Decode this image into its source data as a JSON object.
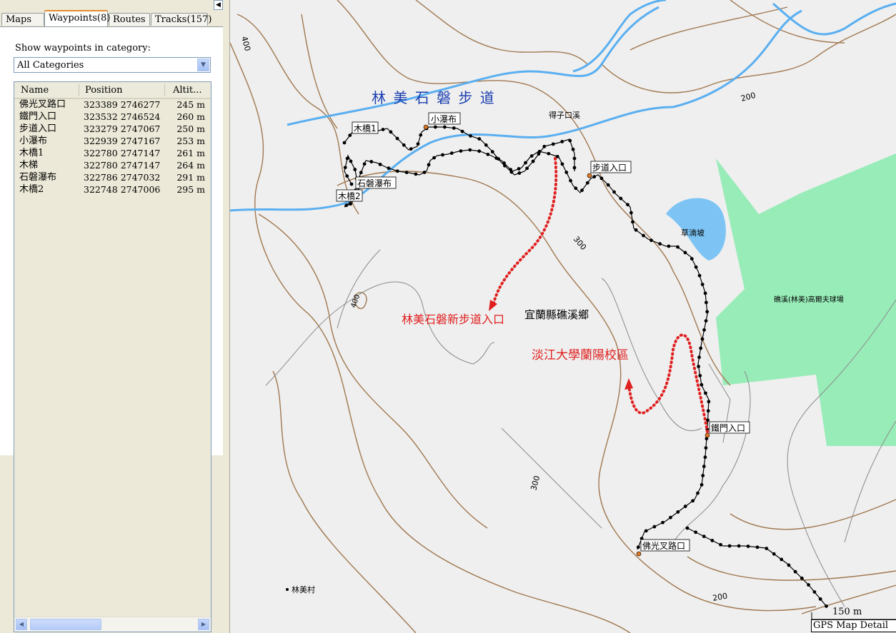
{
  "tabs": [
    {
      "label": "Maps"
    },
    {
      "label": "Waypoints(8)"
    },
    {
      "label": "Routes"
    },
    {
      "label": "Tracks(157)"
    }
  ],
  "category": {
    "label": "Show waypoints in category:",
    "selected": "All Categories"
  },
  "columns": {
    "name": "Name",
    "position": "Position",
    "altitude": "Altit..."
  },
  "waypoints": [
    {
      "name": "佛光叉路口",
      "position": "323389 2746277",
      "altitude": "245 m"
    },
    {
      "name": "鐵門入口",
      "position": "323532 2746524",
      "altitude": "260 m"
    },
    {
      "name": "步道入口",
      "position": "323279 2747067",
      "altitude": "250 m"
    },
    {
      "name": "小瀑布",
      "position": "322939 2747167",
      "altitude": "253 m"
    },
    {
      "name": "木橋1",
      "position": "322780 2747147",
      "altitude": "261 m"
    },
    {
      "name": "木梯",
      "position": "322780 2747147",
      "altitude": "264 m"
    },
    {
      "name": "石磐瀑布",
      "position": "322786 2747032",
      "altitude": "291 m"
    },
    {
      "name": "木橋2",
      "position": "322748 2747006",
      "altitude": "295 m"
    }
  ],
  "map": {
    "title": "林 美 石 磐 步 道",
    "annotation_entrance": "林美石磐新步道入口",
    "annotation_campus": "淡江大學蘭陽校區",
    "township": "宜蘭縣礁溪鄉",
    "stream": "得子口溪",
    "pond": "草湳坡",
    "golf": "礁溪(林美)高爾夫球場",
    "village": "林美村",
    "contours": [
      "400",
      "200",
      "300",
      "400",
      "300",
      "200"
    ],
    "wp_labels": [
      "小瀑布",
      "木橋1",
      "石磐瀑布",
      "木橋2",
      "步道入口",
      "鐵門入口",
      "佛光叉路口"
    ],
    "scale": "150 m",
    "detail": "GPS Map Detail",
    "colors": {
      "contour": "#a07850",
      "river": "#5aaff0",
      "green": "#98ecb8",
      "track": "#000000",
      "annotation": "#e02020",
      "title": "#1a3fb0"
    }
  }
}
